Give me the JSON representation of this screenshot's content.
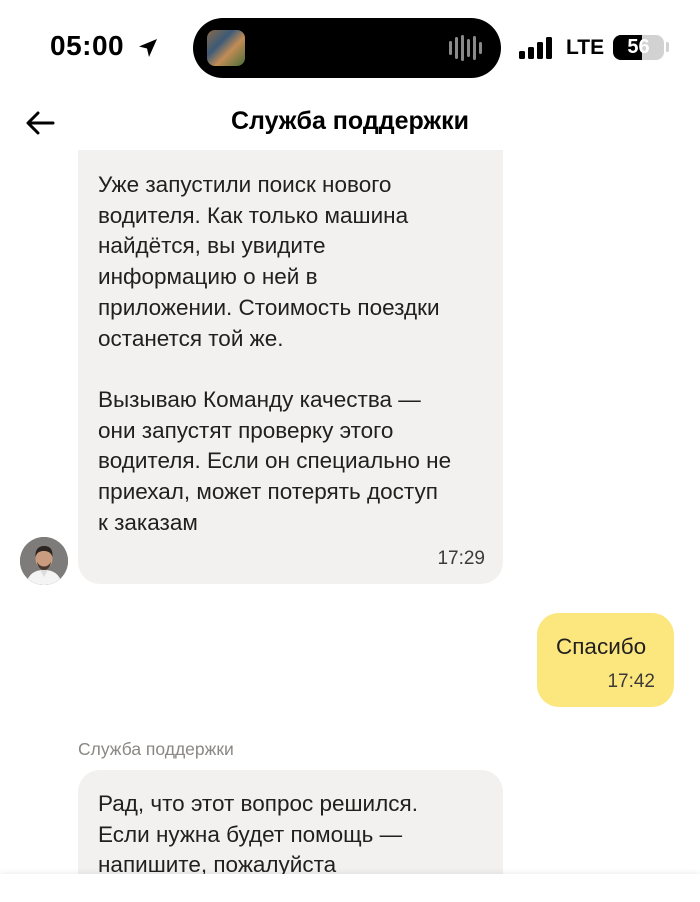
{
  "status_bar": {
    "time": "05:00",
    "network": "LTE",
    "battery": "56",
    "battery_level": 0.56,
    "icons": [
      "location-arrow-icon",
      "now-playing-thumbnail",
      "audio-waveform-icon",
      "cellular-signal-icon",
      "battery-icon"
    ]
  },
  "header": {
    "title": "Служба поддержки",
    "back_icon": "arrow-left-icon"
  },
  "messages": [
    {
      "direction": "incoming",
      "text": "Уже запустили поиск нового\nводителя. Как только машина\nнайдётся, вы увидите\nинформацию о ней в\nприложении. Стоимость поездки\nостанется той же.\n\nВызываю Команду качества —\nони запустят проверку этого\nводителя. Если он специально не\nприехал, может потерять доступ\nк заказам",
      "time": "17:29",
      "avatar": "support-agent-avatar"
    },
    {
      "direction": "outgoing",
      "text": "Спасибо",
      "time": "17:42"
    },
    {
      "direction": "incoming",
      "sender": "Служба поддержки",
      "text": "Рад, что этот вопрос решился.\nЕсли нужна будет помощь —\nнапишите, пожалуйста"
    }
  ],
  "colors": {
    "incoming_bubble": "#f2f1ef",
    "outgoing_bubble": "#fce77f",
    "text": "#21201f",
    "secondary_text": "#8a8784"
  }
}
